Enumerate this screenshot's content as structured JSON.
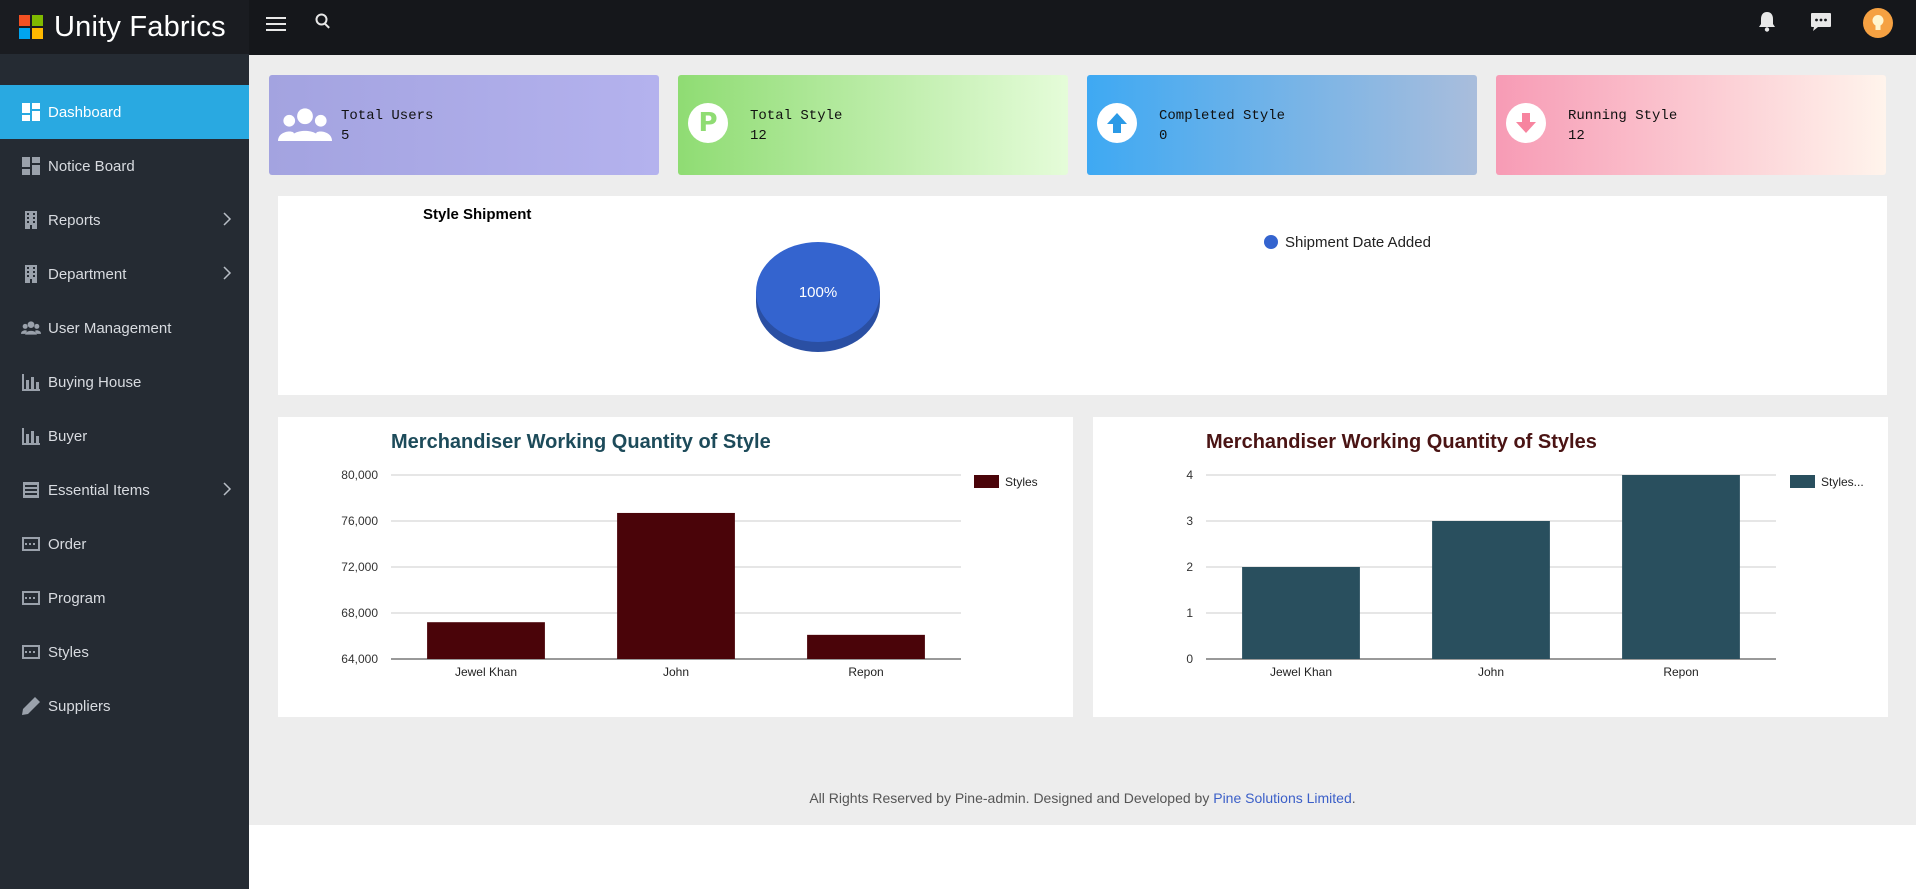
{
  "brand": {
    "title": "Unity Fabrics",
    "logo_colors": [
      "#f25022",
      "#7fba00",
      "#00a4ef",
      "#ffb900"
    ]
  },
  "sidebar": {
    "items": [
      {
        "label": "Dashboard",
        "icon": "dashboard-icon",
        "active": true
      },
      {
        "label": "Notice Board",
        "icon": "dashboard-icon"
      },
      {
        "label": "Reports",
        "icon": "building-icon",
        "submenu": true
      },
      {
        "label": "Department",
        "icon": "building-icon",
        "submenu": true
      },
      {
        "label": "User Management",
        "icon": "users-icon"
      },
      {
        "label": "Buying House",
        "icon": "bar-chart-icon"
      },
      {
        "label": "Buyer",
        "icon": "bar-chart-icon"
      },
      {
        "label": "Essential Items",
        "icon": "list-icon",
        "submenu": true
      },
      {
        "label": "Order",
        "icon": "card-icon"
      },
      {
        "label": "Program",
        "icon": "card-icon"
      },
      {
        "label": "Styles",
        "icon": "card-icon"
      },
      {
        "label": "Suppliers",
        "icon": "pencil-icon"
      }
    ]
  },
  "topbar": {
    "icons": [
      "menu-icon",
      "search-icon",
      "bell-icon",
      "chat-icon",
      "avatar"
    ],
    "avatar_color": "#f5a142"
  },
  "stats": [
    {
      "label": "Total Users",
      "value": "5",
      "icon": "users-icon",
      "gradient": [
        "#a3a3e0",
        "#b4b2ee"
      ]
    },
    {
      "label": "Total Style",
      "value": "12",
      "icon": "p-letter-icon",
      "gradient": [
        "#8fdc73",
        "#e5fcd9"
      ]
    },
    {
      "label": "Completed Style",
      "value": "0",
      "icon": "arrow-up-circle-icon",
      "gradient": [
        "#3ea9f3",
        "#a9bddc"
      ]
    },
    {
      "label": "Running Style",
      "value": "12",
      "icon": "arrow-down-circle-icon",
      "gradient": [
        "#f79bb5",
        "#fff4ec"
      ]
    }
  ],
  "pie_panel": {
    "title": "Style Shipment",
    "slice_label": "100%",
    "legend": "Shipment Date Added"
  },
  "footer": {
    "text": "All Rights Reserved by Pine-admin. Designed and Developed by ",
    "link": "Pine Solutions Limited",
    "period": "."
  },
  "chart_data": [
    {
      "type": "pie",
      "title": "Style Shipment",
      "categories": [
        "Shipment Date Added"
      ],
      "values": [
        100
      ],
      "labels": [
        "100%"
      ],
      "colors": [
        "#3464cf"
      ],
      "legend": "top-right"
    },
    {
      "type": "bar",
      "title": "Merchandiser Working Quantity of Style",
      "categories": [
        "Jewel Khan",
        "John",
        "Repon"
      ],
      "series": [
        {
          "name": "Styles",
          "values": [
            67200,
            76700,
            66100
          ]
        }
      ],
      "ylim": [
        64000,
        80000
      ],
      "yticks": [
        "64,000",
        "68,000",
        "72,000",
        "76,000",
        "80,000"
      ],
      "ytick_values": [
        64000,
        68000,
        72000,
        76000,
        80000
      ],
      "color": "#4a0409",
      "title_color": "#1d4b5a",
      "grid": true,
      "legend": "right"
    },
    {
      "type": "bar",
      "title": "Merchandiser Working Quantity of Styles",
      "categories": [
        "Jewel Khan",
        "John",
        "Repon"
      ],
      "series": [
        {
          "name": "Styles...",
          "values": [
            2,
            3,
            4
          ]
        }
      ],
      "ylim": [
        0,
        4
      ],
      "yticks": [
        "0",
        "1",
        "2",
        "3",
        "4"
      ],
      "ytick_values": [
        0,
        1,
        2,
        3,
        4
      ],
      "color": "#294f5e",
      "title_color": "#4a1414",
      "grid": true,
      "legend": "right"
    }
  ]
}
